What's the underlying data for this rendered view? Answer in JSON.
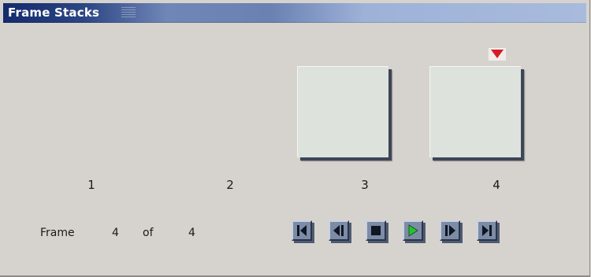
{
  "window": {
    "title": "Frame Stacks"
  },
  "frames": {
    "labels": [
      "1",
      "2",
      "3",
      "4"
    ],
    "current_marker": "triangle-down-icon"
  },
  "counter": {
    "prefix": "Frame",
    "current": "4",
    "separator": "of",
    "total": "4"
  },
  "controls": {
    "icons": [
      "skip-to-first-icon",
      "step-back-icon",
      "stop-icon",
      "play-icon",
      "step-forward-icon",
      "skip-to-last-icon"
    ]
  },
  "colors": {
    "marker": "#d61c2a",
    "play": "#27c22f",
    "title_bar_dark": "#142a6c",
    "title_bar_light": "#a8bbdd"
  }
}
